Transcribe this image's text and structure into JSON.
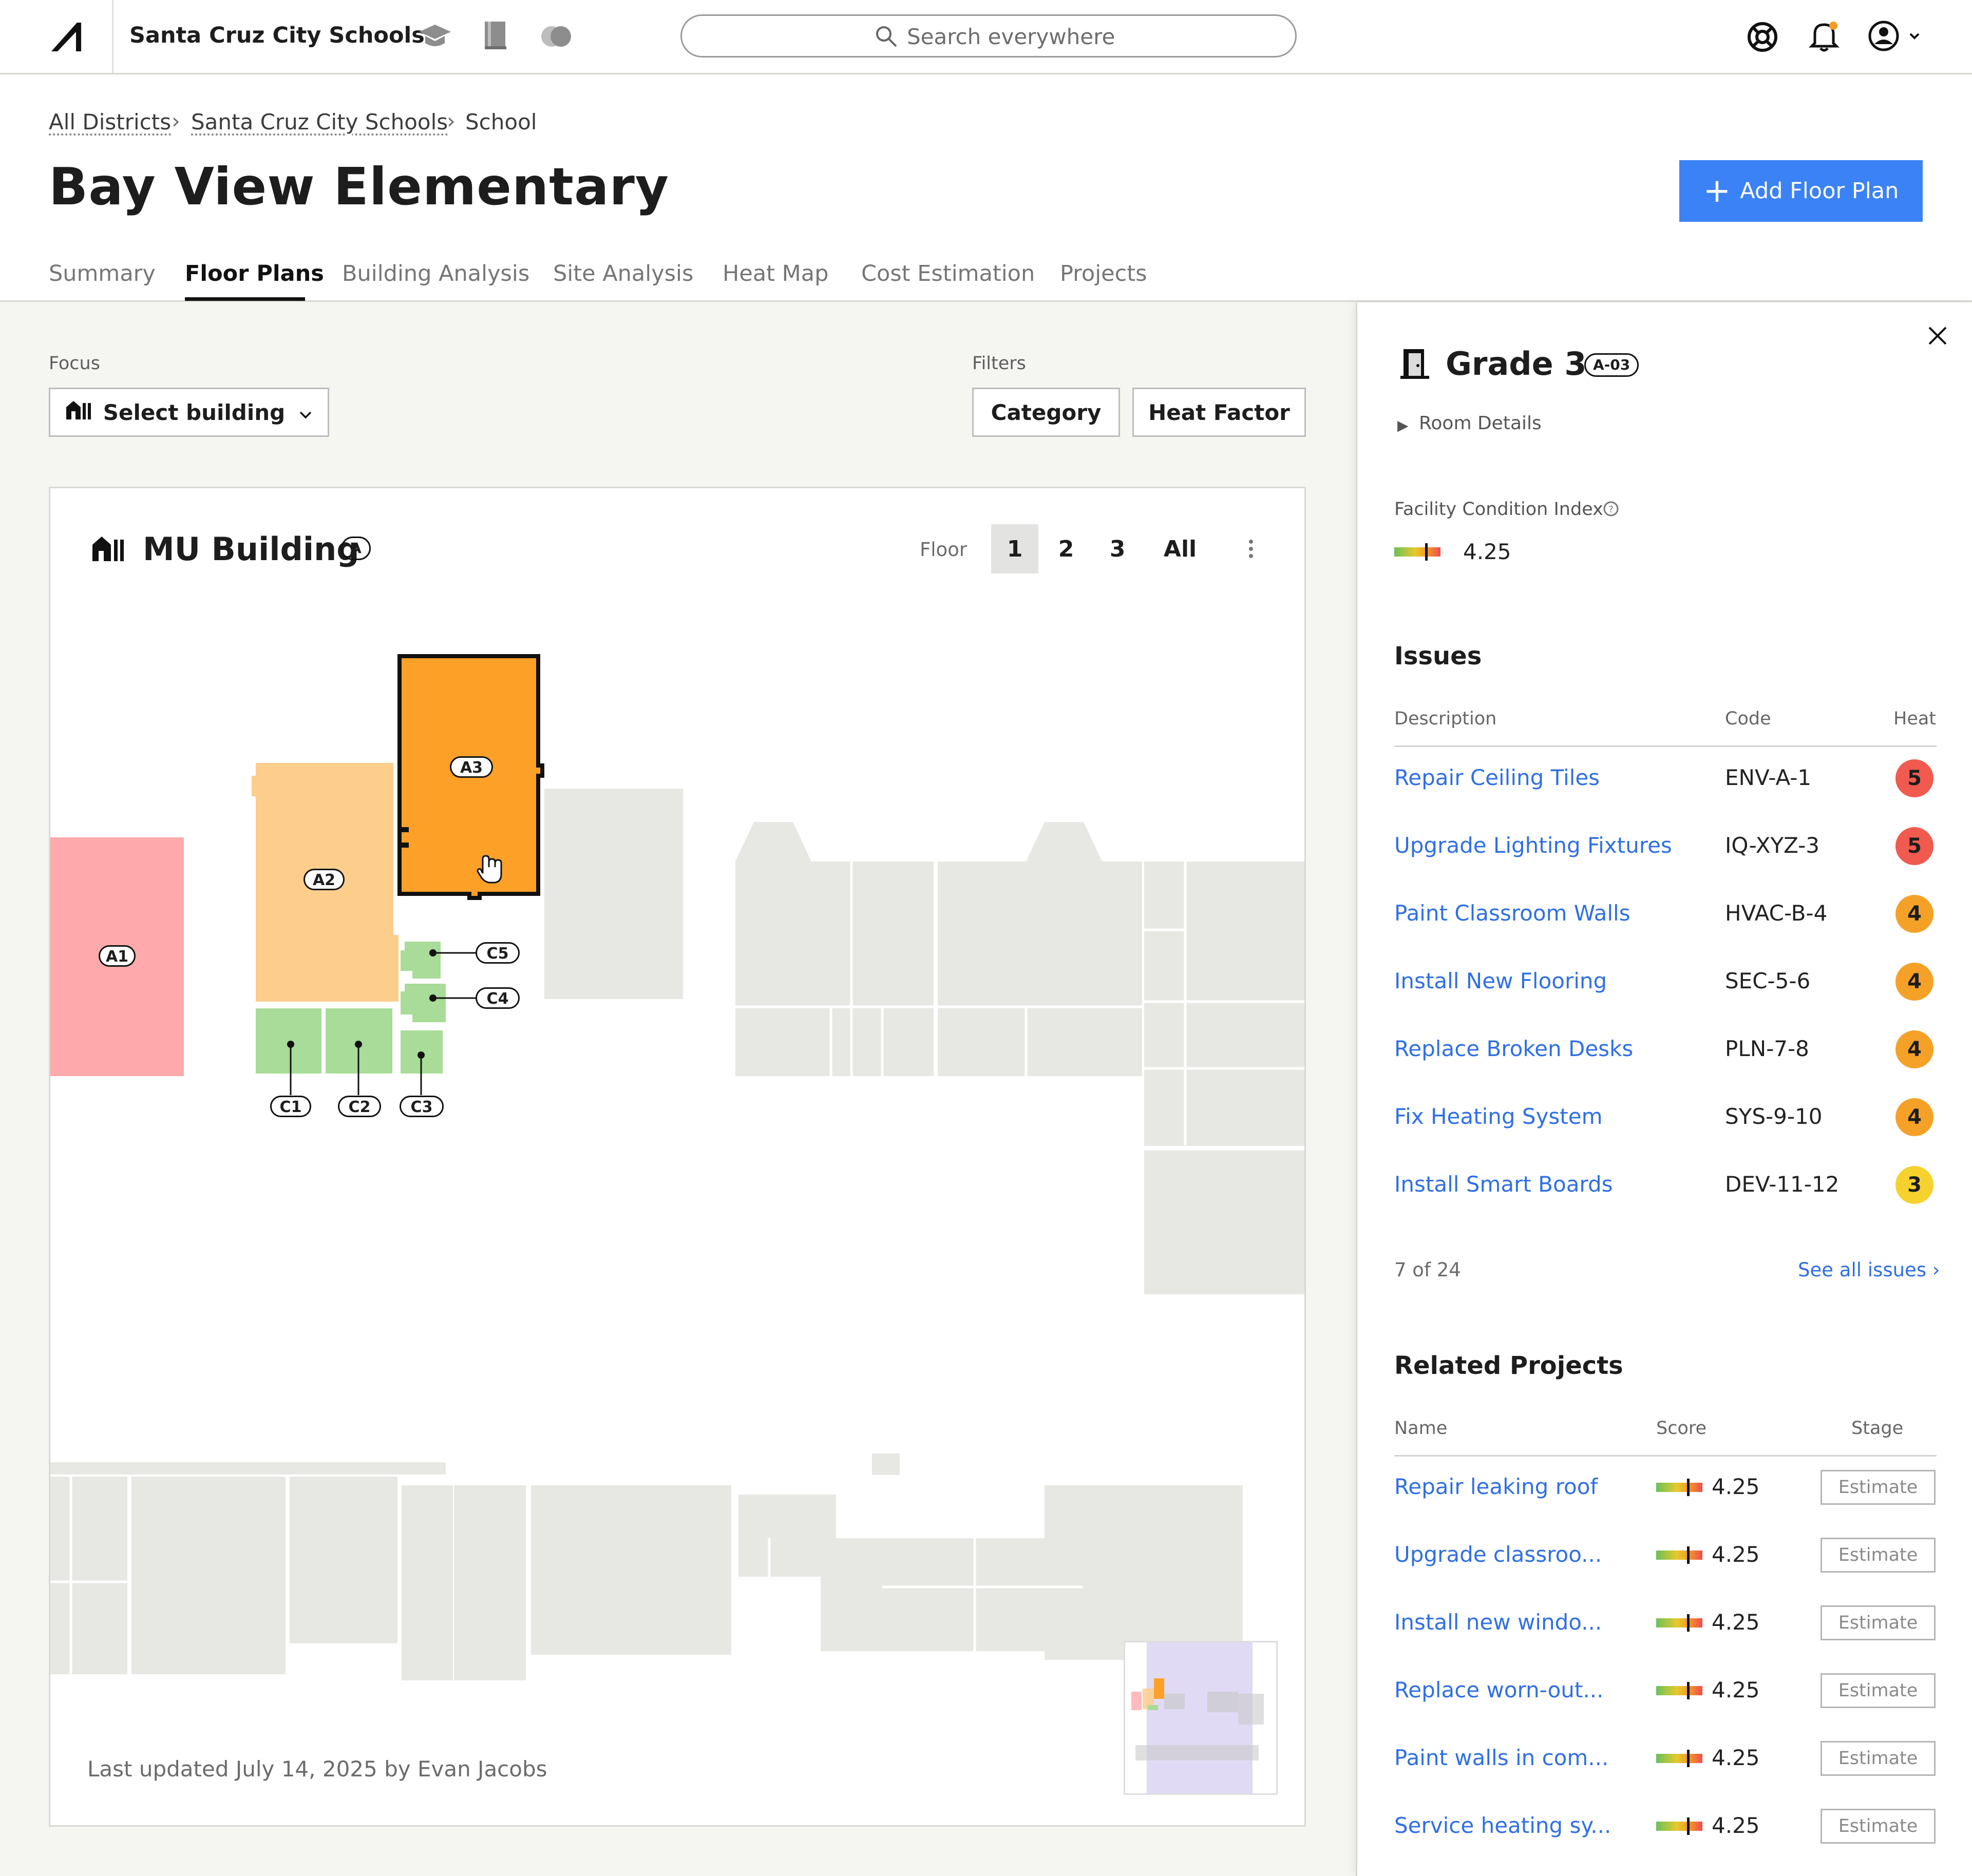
{
  "topbar": {
    "org_name": "Santa Cruz City Schools",
    "search_placeholder": "Search everywhere"
  },
  "breadcrumb": {
    "items": [
      "All Districts",
      "Santa Cruz City Schools",
      "School"
    ]
  },
  "page": {
    "title": "Bay View Elementary",
    "add_button": "Add Floor Plan",
    "accent": "#3b82f6"
  },
  "tabs": [
    "Summary",
    "Floor Plans",
    "Building Analysis",
    "Site Analysis",
    "Heat Map",
    "Cost Estimation",
    "Projects"
  ],
  "focus": {
    "label": "Focus",
    "select_label": "Select building"
  },
  "filters": {
    "label": "Filters",
    "category": "Category",
    "heat_factor": "Heat Factor"
  },
  "map": {
    "building_name": "MU Building",
    "building_code": "A",
    "floor_label": "Floor",
    "floors": [
      "1",
      "2",
      "3",
      "All"
    ],
    "selected_floor": "1",
    "rooms": [
      "A1",
      "A2",
      "A3",
      "C1",
      "C2",
      "C3",
      "C4",
      "C5"
    ],
    "last_updated": "Last updated July 14, 2025 by Evan Jacobs"
  },
  "panel": {
    "room_name": "Grade 3",
    "room_code": "A-03",
    "room_details": "Room Details",
    "fci_label": "Facility Condition Index",
    "fci_value": "4.25",
    "issues_title": "Issues",
    "issues_cols": [
      "Description",
      "Code",
      "Heat"
    ],
    "issues": [
      {
        "desc": "Repair Ceiling Tiles",
        "code": "ENV-A-1",
        "heat": "5"
      },
      {
        "desc": "Upgrade Lighting Fixtures",
        "code": "IQ-XYZ-3",
        "heat": "5"
      },
      {
        "desc": "Paint Classroom Walls",
        "code": "HVAC-B-4",
        "heat": "4"
      },
      {
        "desc": "Install New Flooring",
        "code": "SEC-5-6",
        "heat": "4"
      },
      {
        "desc": "Replace Broken Desks",
        "code": "PLN-7-8",
        "heat": "4"
      },
      {
        "desc": "Fix Heating System",
        "code": "SYS-9-10",
        "heat": "4"
      },
      {
        "desc": "Install Smart Boards",
        "code": "DEV-11-12",
        "heat": "3"
      }
    ],
    "issues_count": "7 of 24",
    "see_all": "See all issues",
    "projects_title": "Related Projects",
    "projects_cols": [
      "Name",
      "Score",
      "Stage"
    ],
    "projects": [
      {
        "name": "Repair leaking roof",
        "score": "4.25",
        "stage": "Estimate"
      },
      {
        "name": "Upgrade classroo...",
        "score": "4.25",
        "stage": "Estimate"
      },
      {
        "name": "Install new windo...",
        "score": "4.25",
        "stage": "Estimate"
      },
      {
        "name": "Replace worn-out...",
        "score": "4.25",
        "stage": "Estimate"
      },
      {
        "name": "Paint walls in com...",
        "score": "4.25",
        "stage": "Estimate"
      },
      {
        "name": "Service heating sy...",
        "score": "4.25",
        "stage": "Estimate"
      }
    ],
    "heat_colors": {
      "5": "#f05a4f",
      "4": "#f5a128",
      "3": "#f6d22f"
    }
  }
}
